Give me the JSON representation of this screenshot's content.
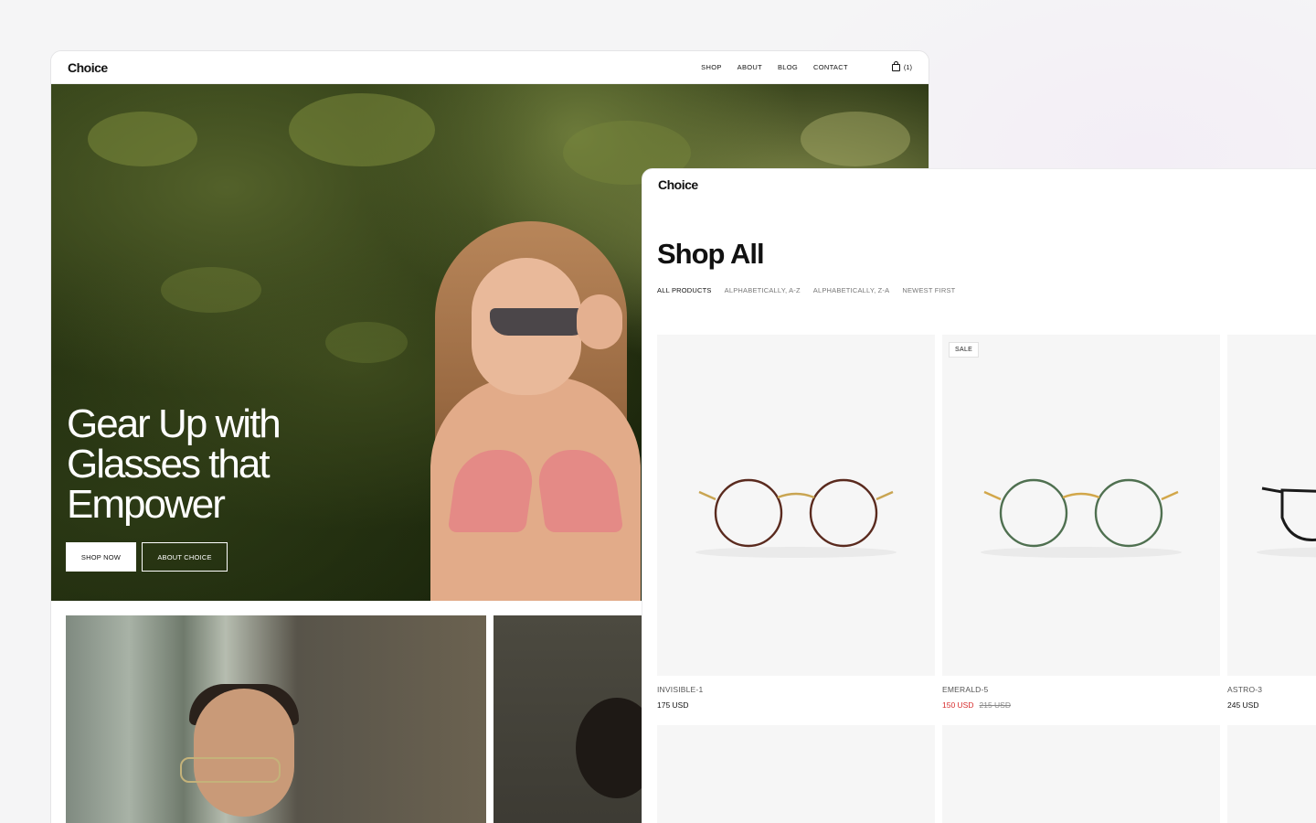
{
  "home": {
    "logo": "Choice",
    "nav": [
      "SHOP",
      "ABOUT",
      "BLOG",
      "CONTACT"
    ],
    "cart_count": "(1)",
    "hero": {
      "title": "Gear Up with Glasses that Empower",
      "primary_button": "SHOP NOW",
      "secondary_button": "ABOUT CHOICE"
    }
  },
  "shop": {
    "logo": "Choice",
    "title": "Shop All",
    "filters": [
      "ALL PRODUCTS",
      "ALPHABETICALLY, A-Z",
      "ALPHABETICALLY, Z-A",
      "NEWEST FIRST"
    ],
    "active_filter": "ALL PRODUCTS",
    "products": [
      {
        "name": "INVISIBLE-1",
        "price": "175 USD",
        "frame_color": "#5a2a1e",
        "bridge_color": "#c9a552"
      },
      {
        "name": "EMERALD-5",
        "badge": "SALE",
        "price": "150 USD",
        "old_price": "215 USD",
        "frame_color": "#4f7050",
        "bridge_color": "#d2a74a"
      },
      {
        "name": "ASTRO-3",
        "price": "245 USD",
        "frame_color": "#1a1a1a",
        "bridge_color": "#1a1a1a"
      }
    ]
  },
  "colors": {
    "background": "#f5f5f6",
    "sale_price": "#d62b2b",
    "text": "#111111"
  }
}
